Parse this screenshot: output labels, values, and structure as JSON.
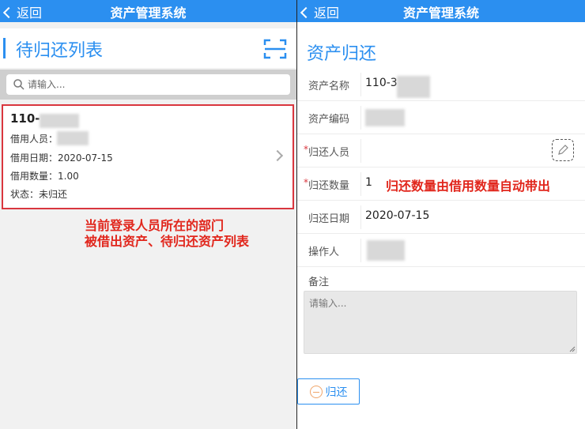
{
  "left": {
    "topbar": {
      "back_label": "返回",
      "title": "资产管理系统"
    },
    "list_title": "待归还列表",
    "search": {
      "placeholder": "请输入..."
    },
    "card": {
      "code": "110-",
      "borrower_label": "借用人员：",
      "borrow_date": "借用日期：2020-07-15",
      "borrow_qty": "借用数量：1.00",
      "status": "状态：未归还"
    },
    "annotation": [
      "当前登录人员所在的部门",
      "被借出资产、待归还资产列表"
    ]
  },
  "right": {
    "topbar": {
      "back_label": "返回",
      "title": "资产管理系统"
    },
    "form_title": "资产归还",
    "fields": {
      "asset_name": {
        "label": "资产名称",
        "value": "110-3"
      },
      "asset_code": {
        "label": "资产编码",
        "value": ""
      },
      "return_person": {
        "label": "归还人员",
        "required_mark": "*"
      },
      "return_qty": {
        "label": "归还数量",
        "required_mark": "*",
        "value": "1"
      },
      "return_date": {
        "label": "归还日期",
        "value": "2020-07-15"
      },
      "operator": {
        "label": "操作人",
        "value": ""
      }
    },
    "annotation": "归还数量由借用数量自动带出",
    "note": {
      "label": "备注",
      "placeholder": "请输入..."
    },
    "return_button": "归还"
  },
  "colors": {
    "accent": "#2b8ff0",
    "highlight": "#d9363e",
    "annotation": "#e1261c"
  }
}
